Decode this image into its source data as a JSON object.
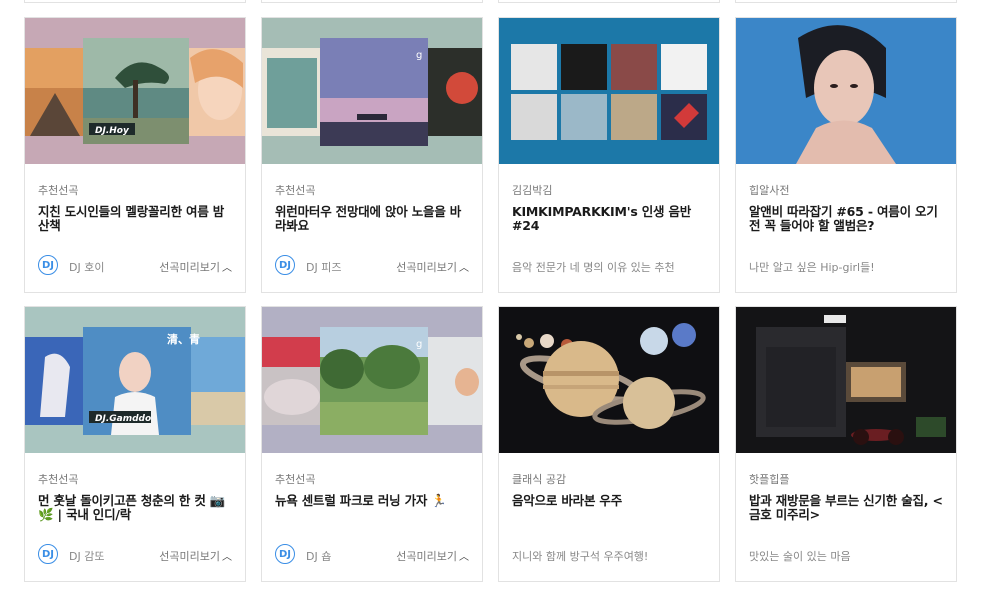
{
  "cards": [
    {
      "category": "추천선곡",
      "title": "지친 도시인들의 멜랑꼴리한 여름 밤 산책",
      "dj_badge": "DJ",
      "dj_name": "DJ 호이",
      "preview_label": "선곡미리보기",
      "thumb_label": "DJ.Hoy",
      "thumb_colors": {
        "bg": "#c6a8b5",
        "center": "#4f7a75"
      }
    },
    {
      "category": "추천선곡",
      "title": "위런마터우 전망대에 앉아 노을을 바라봐요",
      "dj_badge": "DJ",
      "dj_name": "DJ 피즈",
      "preview_label": "선곡미리보기",
      "thumb_label": "g",
      "thumb_colors": {
        "bg": "#a5bdb5",
        "center": "#8d87b8"
      }
    },
    {
      "category": "김김박김",
      "title": "KIMKIMPARKKIM's 인생 음반 #24",
      "description": "음악 전문가 네 명의 이유 있는 추천",
      "thumb_colors": {
        "bg": "#1c78a8"
      }
    },
    {
      "category": "힙알사전",
      "title": "알앤비 따라잡기 #65 - 여름이 오기 전 꼭 들어야 할 앨범은?",
      "description": "나만 알고 싶은 Hip-girl들!",
      "thumb_colors": {
        "bg": "#3b86c8"
      }
    },
    {
      "category": "추천선곡",
      "title": "먼 훗날 돌이키고픈 청춘의 한 컷 📷🌿 | 국내 인디/락",
      "dj_badge": "DJ",
      "dj_name": "DJ 감또",
      "preview_label": "선곡미리보기",
      "thumb_label": "DJ.Gamddo",
      "thumb_top_text": "清、青",
      "thumb_colors": {
        "bg": "#a9c5c0",
        "center": "#4f8dc4"
      }
    },
    {
      "category": "추천선곡",
      "title": "뉴욕 센트럴 파크로 러닝 가자 🏃",
      "dj_badge": "DJ",
      "dj_name": "DJ 숍",
      "preview_label": "선곡미리보기",
      "thumb_label": "g",
      "thumb_colors": {
        "bg": "#b2b0c4",
        "center": "#6e9a57"
      }
    },
    {
      "category": "클래식 공감",
      "title": "음악으로 바라본 우주",
      "description": "지니와 함께 방구석 우주여행!",
      "thumb_colors": {
        "bg": "#0f0f12"
      }
    },
    {
      "category": "핫플힙플",
      "title": "밥과 재방문을 부르는 신기한 술집, <금호 미주리>",
      "description": "맛있는 술이 있는 마음",
      "thumb_colors": {
        "bg": "#141416"
      }
    }
  ]
}
